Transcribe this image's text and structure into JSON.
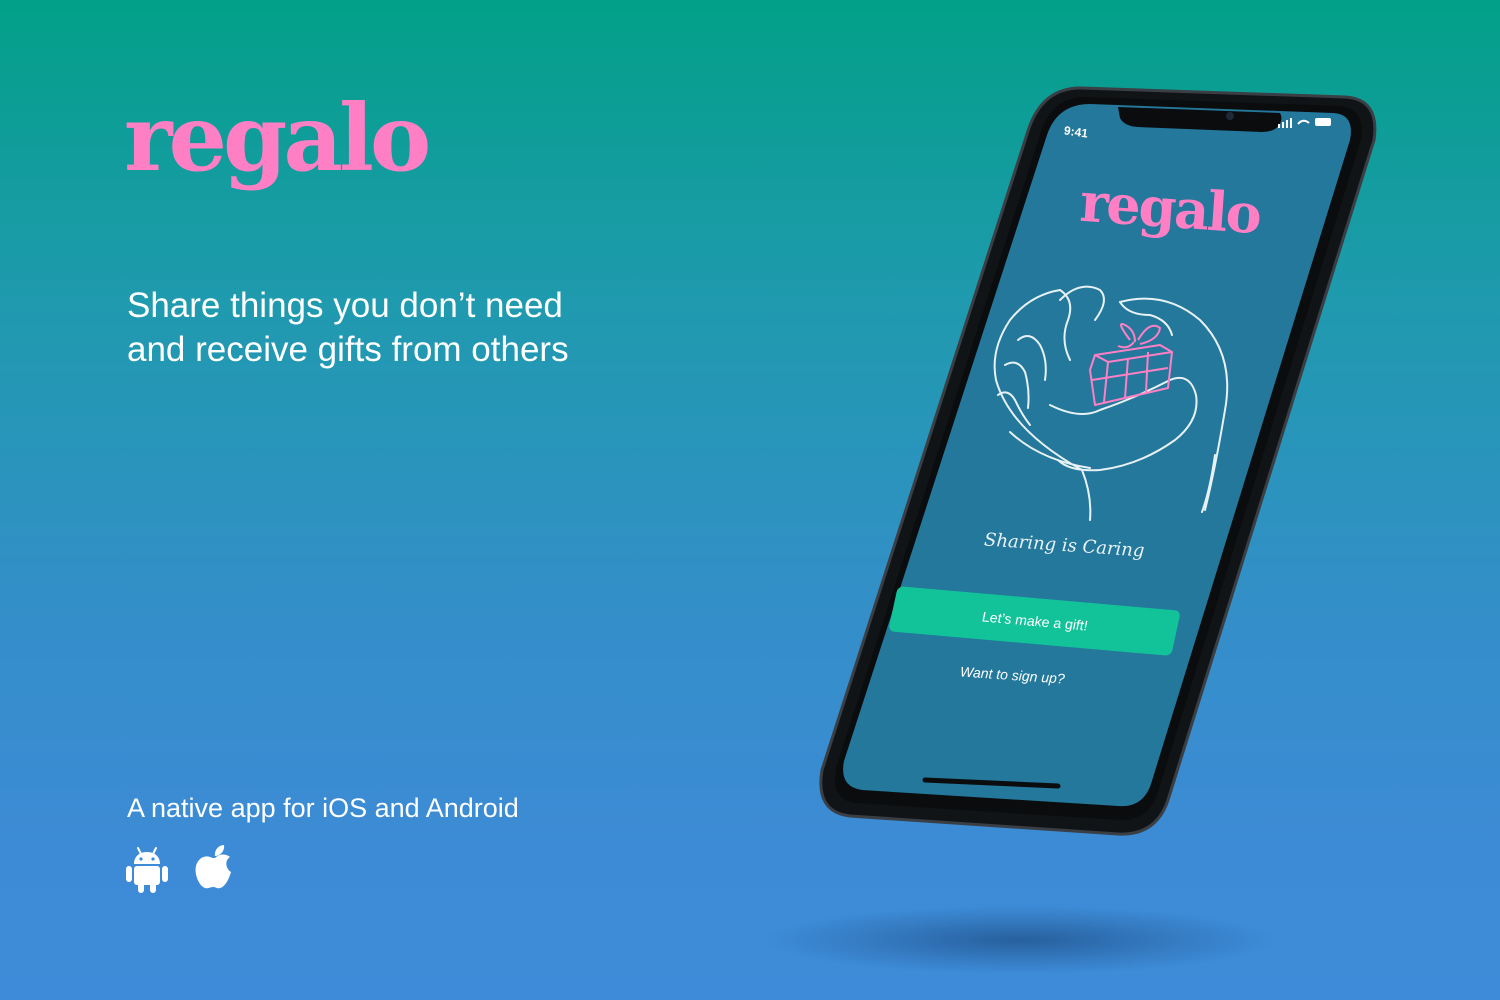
{
  "brand": {
    "name": "regalo"
  },
  "hero": {
    "tagline_line1": "Share things you don’t need",
    "tagline_line2": "and receive gifts from others"
  },
  "platforms": {
    "label": "A native app for iOS and Android",
    "icons": [
      "android-icon",
      "apple-icon"
    ]
  },
  "phone_screen": {
    "status_time": "9:41",
    "app_logo": "regalo",
    "illustration": "hand-holding-gift-illustration",
    "caption": "Sharing is Caring",
    "primary_button": "Let’s make a gift!",
    "secondary_link": "Want to sign up?"
  },
  "colors": {
    "background_top": "#02a088",
    "background_bottom": "#3e8cd9",
    "brand_pink": "#ff7fc4",
    "screen_background": "#23789b",
    "button_green": "#12c39a"
  }
}
